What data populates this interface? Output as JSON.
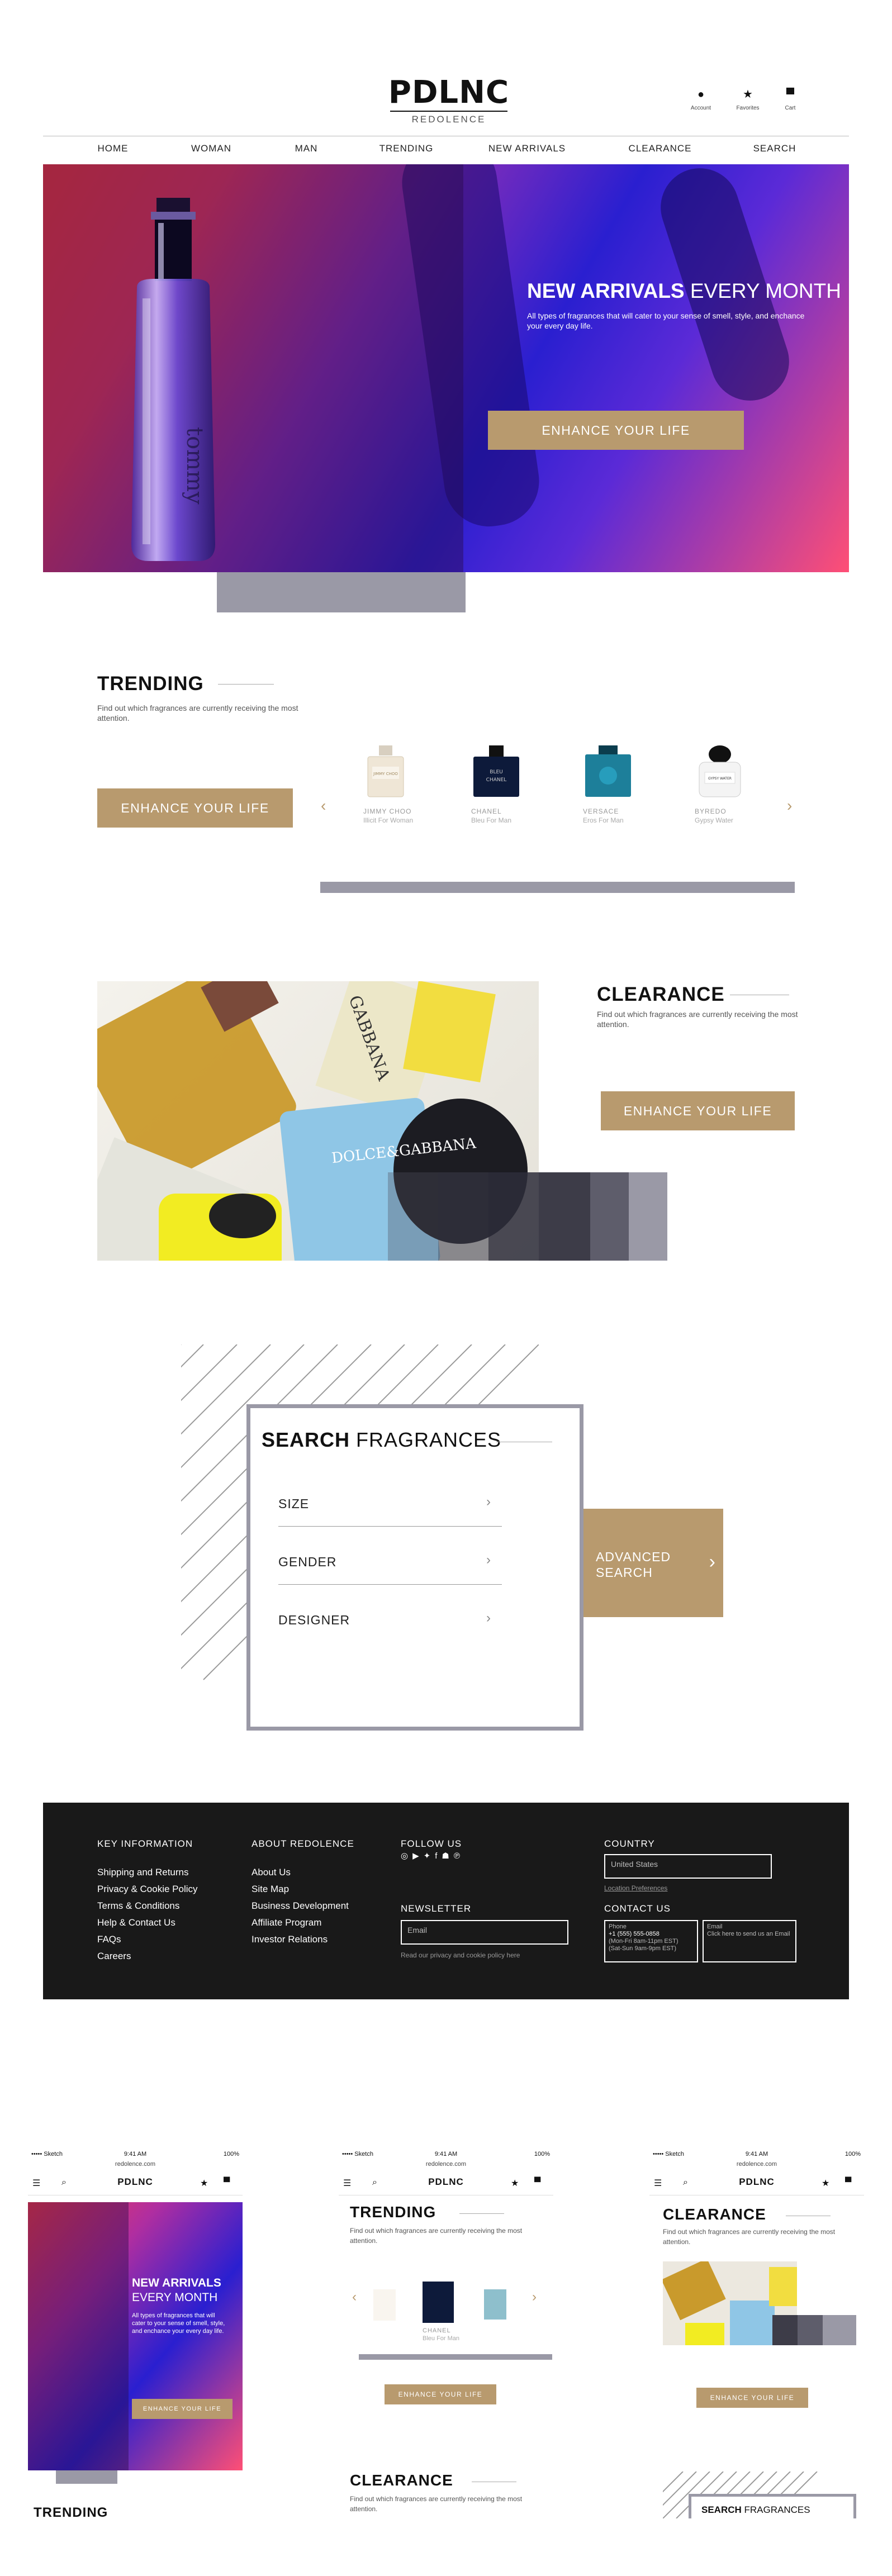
{
  "brand": {
    "logo": "PDLNC",
    "tagline": "REDOLENCE"
  },
  "header_icons": [
    {
      "glyph": "●",
      "label": "Account"
    },
    {
      "glyph": "★",
      "label": "Favorites"
    },
    {
      "glyph": "▀",
      "label": "Cart"
    }
  ],
  "nav": [
    "HOME",
    "WOMAN",
    "MAN",
    "TRENDING",
    "NEW ARRIVALS",
    "CLEARANCE",
    "SEARCH"
  ],
  "hero": {
    "title_bold": "NEW ARRIVALS",
    "title_light": " EVERY MONTH",
    "description": "All types of fragrances that will cater to your sense of smell, style, and enchance your every day life.",
    "button": "ENHANCE YOUR LIFE"
  },
  "trending": {
    "title": "TRENDING",
    "description": "Find out which fragrances are currently receiving the most attention.",
    "button": "ENHANCE YOUR LIFE",
    "products": [
      {
        "name": "JIMMY CHOO",
        "sub": "Illicit For Woman"
      },
      {
        "name": "CHANEL",
        "sub": "Bleu For Man"
      },
      {
        "name": "VERSACE",
        "sub": "Eros For Man"
      },
      {
        "name": "BYREDO",
        "sub": "Gypsy Water"
      }
    ]
  },
  "clearance": {
    "title": "CLEARANCE",
    "description": "Find out which fragrances are currently receiving the most attention.",
    "button": "ENHANCE YOUR LIFE"
  },
  "search": {
    "title_bold": "SEARCH",
    "title_light": " FRAGRANCES",
    "facets": [
      "SIZE",
      "GENDER",
      "DESIGNER"
    ],
    "advanced_line1": "ADVANCED",
    "advanced_line2": "SEARCH"
  },
  "footer": {
    "key_info": {
      "heading": "KEY INFORMATION",
      "links": [
        "Shipping and Returns",
        "Privacy & Cookie Policy",
        "Terms & Conditions",
        "Help & Contact Us",
        "FAQs",
        "Careers"
      ]
    },
    "about": {
      "heading": "ABOUT REDOLENCE",
      "links": [
        "About Us",
        "Site Map",
        "Business Development",
        "Affiliate Program",
        "Investor Relations"
      ]
    },
    "follow_heading": "FOLLOW US",
    "newsletter": {
      "heading": "NEWSLETTER",
      "placeholder": "Email",
      "note": "Read our privacy and cookie policy here"
    },
    "country": {
      "heading": "COUNTRY",
      "value": "United States",
      "link": "Location Preferences"
    },
    "contact": {
      "heading": "CONTACT US",
      "phone_label": "Phone",
      "phone": "+1 (555) 555-0858",
      "hours1": "(Mon-Fri 8am-11pm EST)",
      "hours2": "(Sat-Sun 9am-9pm EST)",
      "email_label": "Email",
      "email_text": "Click here to send us an Email"
    }
  },
  "mobile": {
    "status_left": "••••• Sketch",
    "time": "9:41 AM",
    "battery": "100%",
    "url": "redolence.com",
    "logo": "PDLNC",
    "s1": {
      "title_bold": "NEW ARRIVALS",
      "title_light": "EVERY MONTH",
      "desc": "All types of fragrances that will cater to your sense of smell, style, and enchance your every day life.",
      "button": "ENHANCE YOUR LIFE",
      "bottom": "TRENDING"
    },
    "s2": {
      "title": "TRENDING",
      "desc": "Find out which fragrances are currently receiving the most attention.",
      "prod_name": "CHANEL",
      "prod_sub": "Bleu For Man",
      "button": "ENHANCE YOUR LIFE",
      "title2": "CLEARANCE",
      "desc2": "Find out which fragrances are currently receiving the most attention."
    },
    "s3": {
      "title": "CLEARANCE",
      "desc": "Find out which fragrances are currently receiving the most attention.",
      "button": "ENHANCE YOUR LIFE",
      "search_bold": "SEARCH",
      "search_light": " FRAGRANCES"
    }
  }
}
